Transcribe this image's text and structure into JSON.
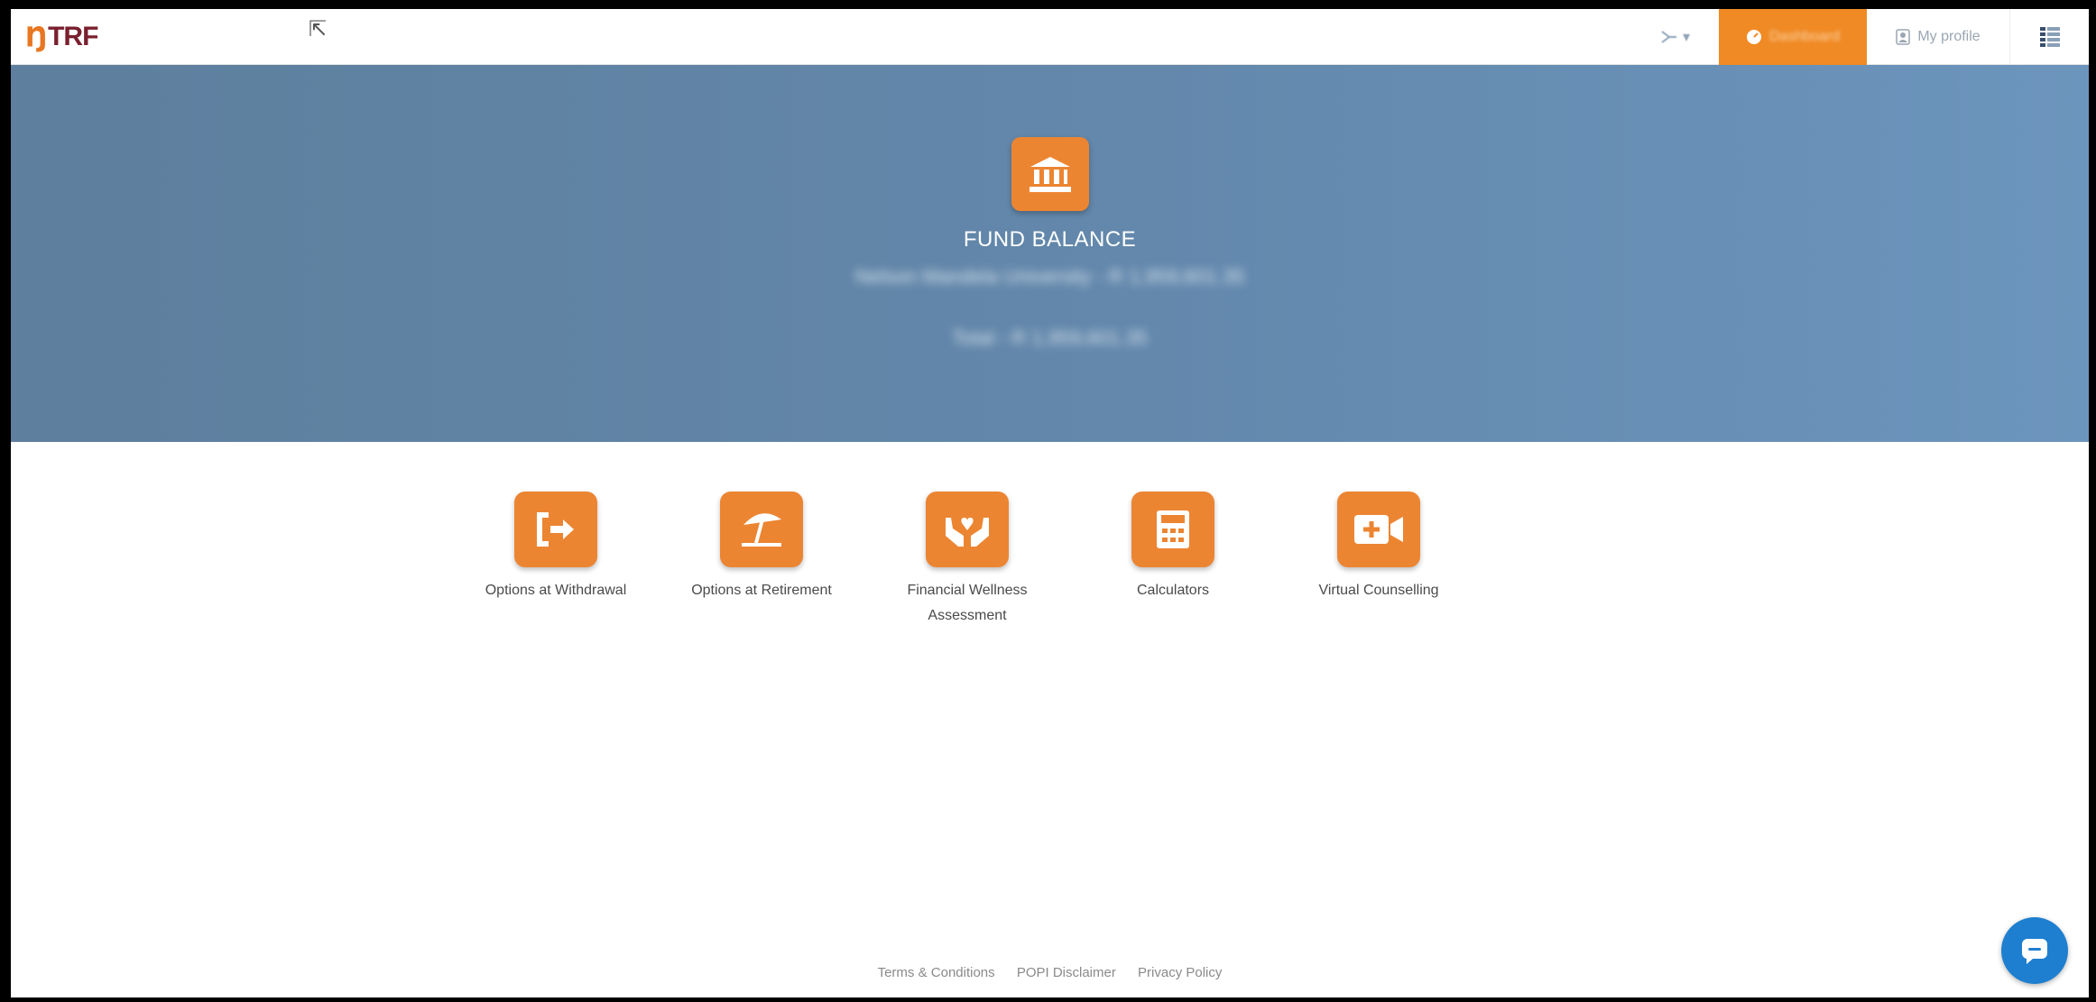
{
  "header": {
    "logo_mark": "Ŋ",
    "logo_text": "TRF",
    "lang_label": "▾",
    "dashboard_label": "Dashboard",
    "profile_label": "My profile"
  },
  "hero": {
    "title": "FUND BALANCE",
    "employer_line": "Nelson Mandela University - R 1,959,601.35",
    "total_line": "Total - R 1,959,601.35"
  },
  "tiles": [
    {
      "label": "Options at Withdrawal",
      "icon": "exit-icon"
    },
    {
      "label": "Options at Retirement",
      "icon": "beach-umbrella-icon"
    },
    {
      "label": "Financial Wellness Assessment",
      "icon": "hands-heart-icon"
    },
    {
      "label": "Calculators",
      "icon": "calculator-icon"
    },
    {
      "label": "Virtual Counselling",
      "icon": "video-call-icon"
    }
  ],
  "footer": {
    "terms": "Terms & Conditions",
    "popi": "POPI Disclaimer",
    "privacy": "Privacy Policy"
  },
  "colors": {
    "accent": "#ec8532",
    "hero_bg": "#6388ac",
    "chat": "#1e7fd0"
  }
}
